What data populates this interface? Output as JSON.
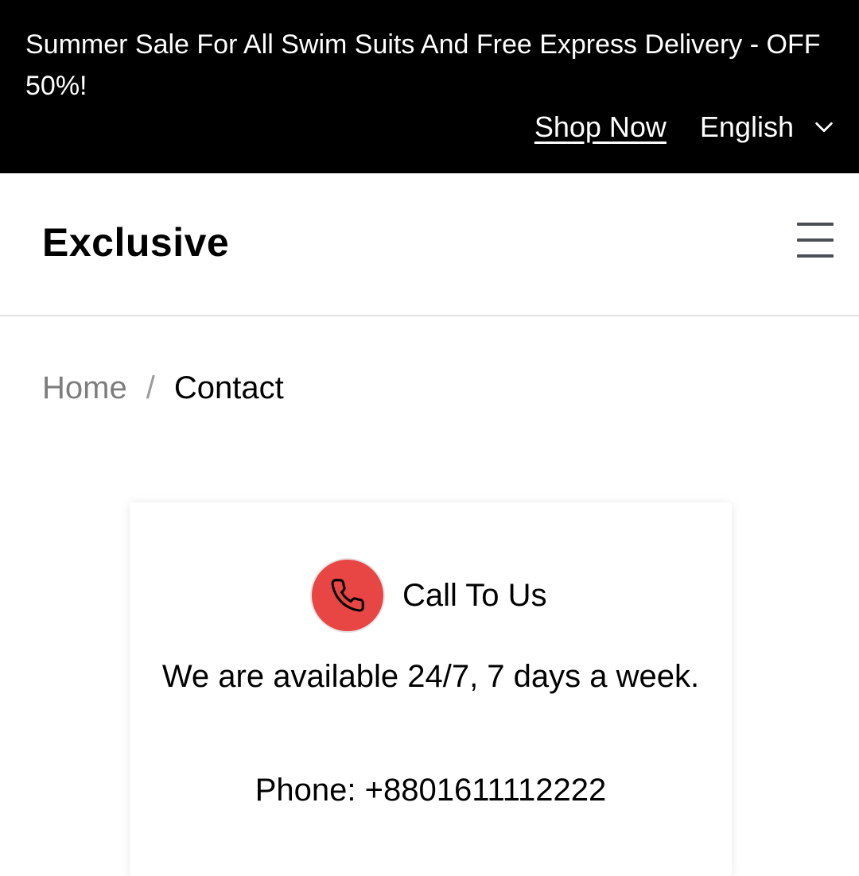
{
  "topbar": {
    "promo_text": "Summer Sale For All Swim Suits And Free Express Delivery - OFF 50%!",
    "shop_link": "Shop Now",
    "language": "English"
  },
  "header": {
    "logo": "Exclusive",
    "menu_icon": "hamburger-menu-icon"
  },
  "breadcrumb": {
    "home": "Home",
    "separator": "/",
    "current": "Contact"
  },
  "contact_card": {
    "icon": "phone-icon",
    "title": "Call To Us",
    "availability": "We are available 24/7, 7 days a week.",
    "phone": "Phone: +8801611112222"
  },
  "colors": {
    "topbar_bg": "#000000",
    "accent": "#e84545",
    "muted_text": "#7d7d7d"
  }
}
